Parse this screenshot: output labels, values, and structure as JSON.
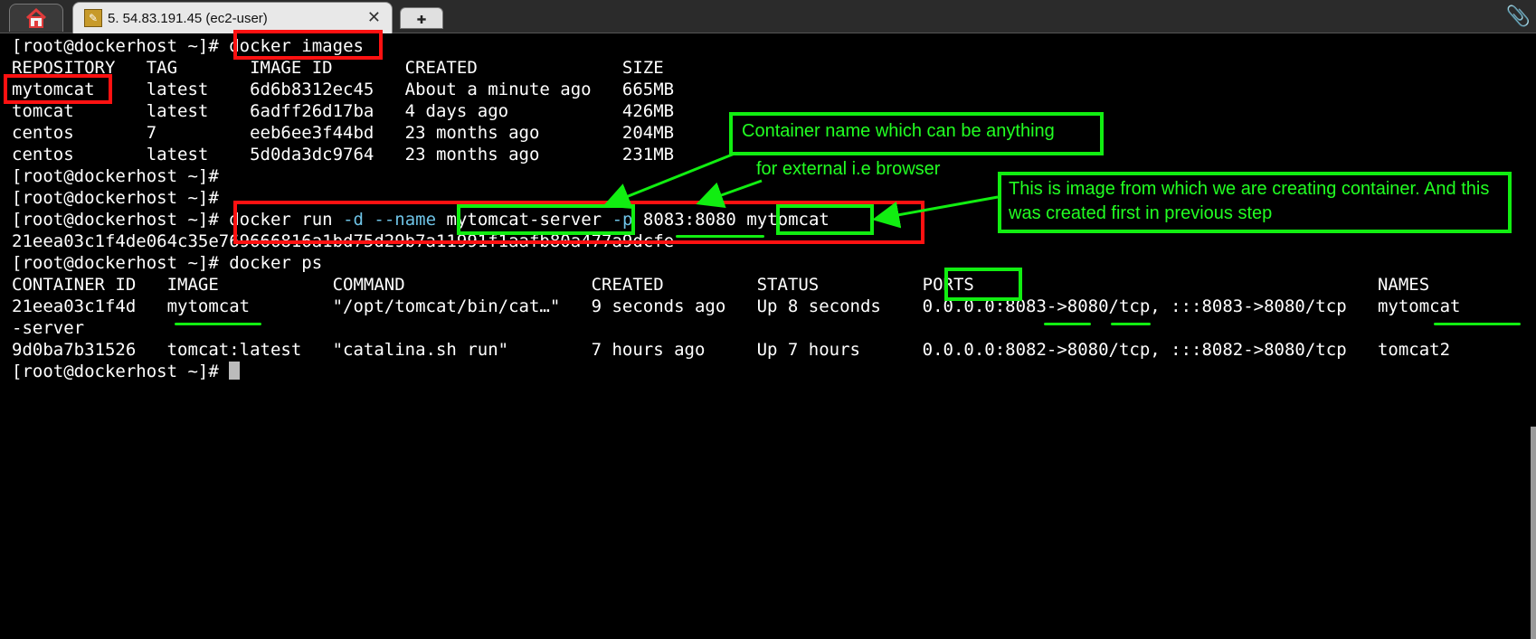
{
  "tabs": {
    "home_icon": "home-icon",
    "session_label": "5. 54.83.191.45 (ec2-user)",
    "close_glyph": "✕",
    "new_tab_glyph": "✚"
  },
  "terminal": {
    "prompt": "[root@dockerhost ~]#",
    "cmd_images": "docker images",
    "images_header": "REPOSITORY   TAG       IMAGE ID       CREATED              SIZE",
    "images_rows": [
      "mytomcat     latest    6d6b8312ec45   About a minute ago   665MB",
      "tomcat       latest    6adff26d17ba   4 days ago           426MB",
      "centos       7         eeb6ee3f44bd   23 months ago        204MB",
      "centos       latest    5d0da3dc9764   23 months ago        231MB"
    ],
    "run_cmd": {
      "docker_run": "docker run",
      "flag_d": "-d",
      "flag_name": "--name",
      "name": "mytomcat-server",
      "flag_p": "-p",
      "ports": "8083:8080",
      "image": "mytomcat"
    },
    "container_hash": "21eea03c1f4de064c35e769666816a1bd75d29b7a11991f1aafb80a477a9dcfe",
    "cmd_ps": "docker ps",
    "ps_header": "CONTAINER ID   IMAGE           COMMAND                  CREATED         STATUS          PORTS                                       NAMES",
    "ps_row1": "21eea03c1f4d   mytomcat        \"/opt/tomcat/bin/cat…\"   9 seconds ago   Up 8 seconds    0.0.0.0:8083->8080/tcp, :::8083->8080/tcp   mytomcat",
    "ps_row1_wrap": "-server",
    "ps_row2": "9d0ba7b31526   tomcat:latest   \"catalina.sh run\"        7 hours ago     Up 7 hours      0.0.0.0:8082->8080/tcp, :::8082->8080/tcp   tomcat2"
  },
  "annotations": {
    "container_name_note": "Container name which can be anything",
    "external_note": "for external i.e browser",
    "image_note": "This is image from which we  are creating container. And this was created first in previous step"
  },
  "colors": {
    "annotation_red": "#ff1111",
    "annotation_green": "#11ee11",
    "command_flag_cyan": "#6ec3e6"
  }
}
